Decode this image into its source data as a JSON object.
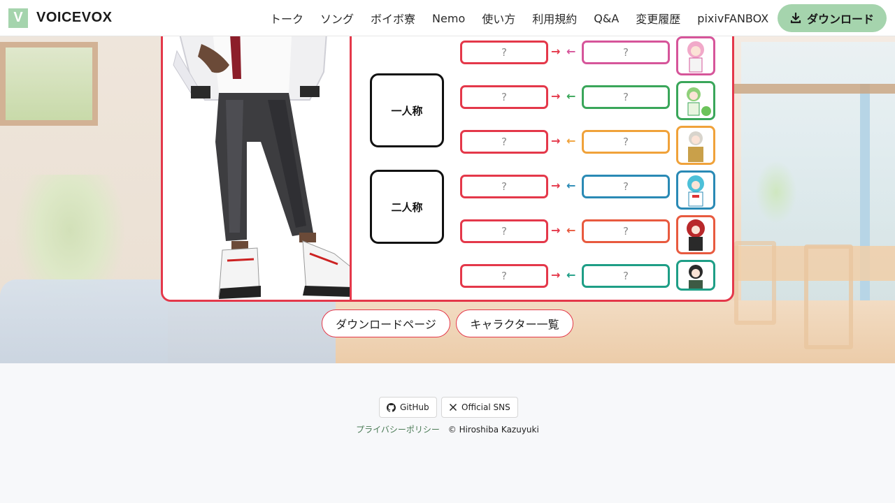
{
  "header": {
    "logo_letter": "V",
    "logo_text": "VOICEVOX",
    "nav": [
      "トーク",
      "ソング",
      "ボイボ寮",
      "Nemo",
      "使い方",
      "利用規約",
      "Q&A",
      "変更履歴",
      "pixivFANBOX"
    ],
    "download_label": "ダウンロード"
  },
  "relation": {
    "labels": [
      "一人称",
      "二人称"
    ],
    "placeholder": "?",
    "rows": [
      {
        "color": "#d6559a",
        "arrow_left": "→",
        "arrow_right": "←"
      },
      {
        "color": "#3aa65a",
        "arrow_left": "→",
        "arrow_right": "←"
      },
      {
        "color": "#f0a23a",
        "arrow_left": "→",
        "arrow_right": "←"
      },
      {
        "color": "#2a8ab5",
        "arrow_left": "→",
        "arrow_right": "←"
      },
      {
        "color": "#e85a3f",
        "arrow_left": "→",
        "arrow_right": "←"
      },
      {
        "color": "#1e9e86",
        "arrow_left": "→",
        "arrow_right": "←"
      }
    ]
  },
  "buttons": {
    "download_page": "ダウンロードページ",
    "character_list": "キャラクター一覧"
  },
  "footer": {
    "github": "GitHub",
    "sns": "Official SNS",
    "privacy": "プライバシーポリシー",
    "copyright": "© Hiroshiba Kazuyuki"
  },
  "colors": {
    "accent": "#e4384a",
    "brand_green": "#a5d4ad"
  }
}
